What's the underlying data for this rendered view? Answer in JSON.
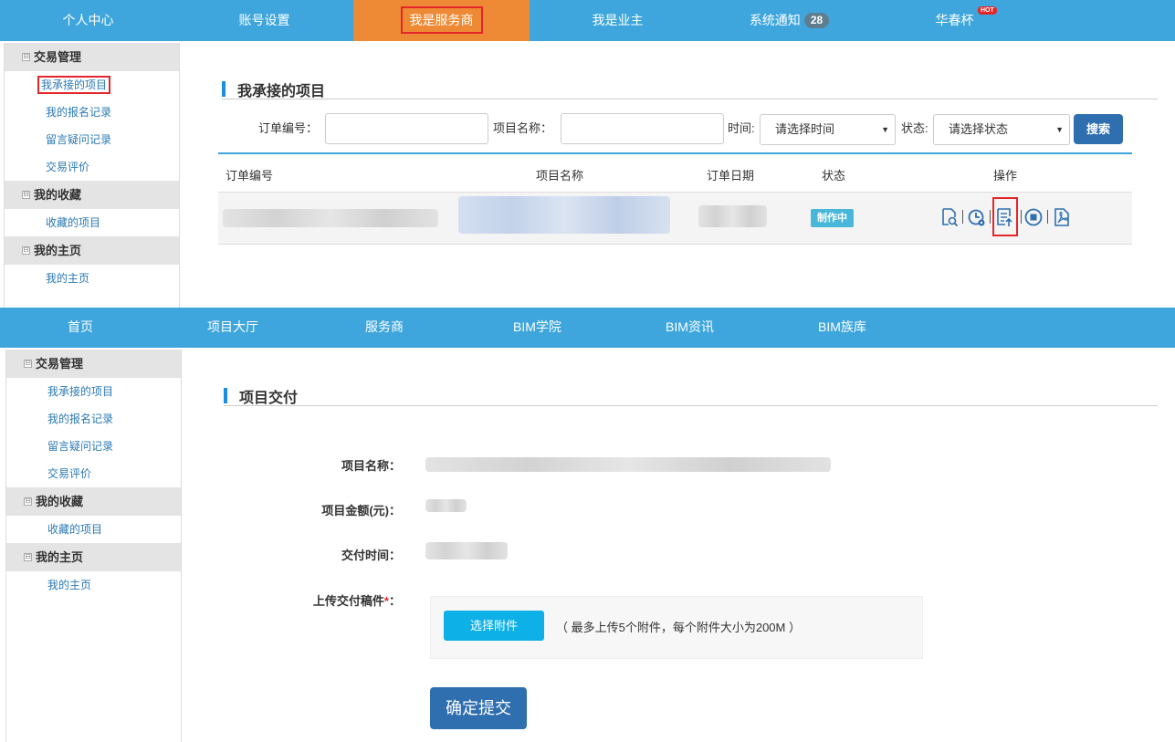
{
  "top_nav": {
    "items": [
      "个人中心",
      "账号设置",
      "我是服务商",
      "我是业主",
      "系统通知",
      "华春杯"
    ],
    "notify_count": "28",
    "hot_tag": "HOT"
  },
  "sidebar": {
    "sections": [
      {
        "title": "交易管理",
        "items": [
          "我承接的项目",
          "我的报名记录",
          "留言疑问记录",
          "交易评价"
        ]
      },
      {
        "title": "我的收藏",
        "items": [
          "收藏的项目"
        ]
      },
      {
        "title": "我的主页",
        "items": [
          "我的主页"
        ]
      }
    ],
    "collapse_glyph": "⊟"
  },
  "projects": {
    "title": "我承接的项目",
    "filter": {
      "order_label": "订单编号：",
      "name_label": "项目名称：",
      "time_label": "时间:",
      "time_value": "请选择时间",
      "status_label": "状态:",
      "status_value": "请选择状态",
      "search_button": "搜索"
    },
    "table": {
      "headers": [
        "订单编号",
        "项目名称",
        "订单日期",
        "状态",
        "操作"
      ],
      "rows": [
        {
          "status": "制作中"
        }
      ]
    }
  },
  "site_nav": {
    "items": [
      "首页",
      "项目大厅",
      "服务商",
      "BIM学院",
      "BIM资讯",
      "BIM族库"
    ]
  },
  "delivery": {
    "title": "项目交付",
    "labels": {
      "name": "项目名称：",
      "amount": "项目金额(元)：",
      "time": "交付时间：",
      "upload": "上传交付稿件",
      "required_mark": "*",
      "colon": "："
    },
    "upload_button": "选择附件",
    "upload_hint": "（ 最多上传5个附件，每个附件大小为200M ）",
    "submit_button": "确定提交"
  },
  "colors": {
    "nav_blue": "#3ea6dd",
    "active_orange": "#ee8a35",
    "highlight_red": "#e3262a",
    "primary_button": "#2f6fb0"
  }
}
